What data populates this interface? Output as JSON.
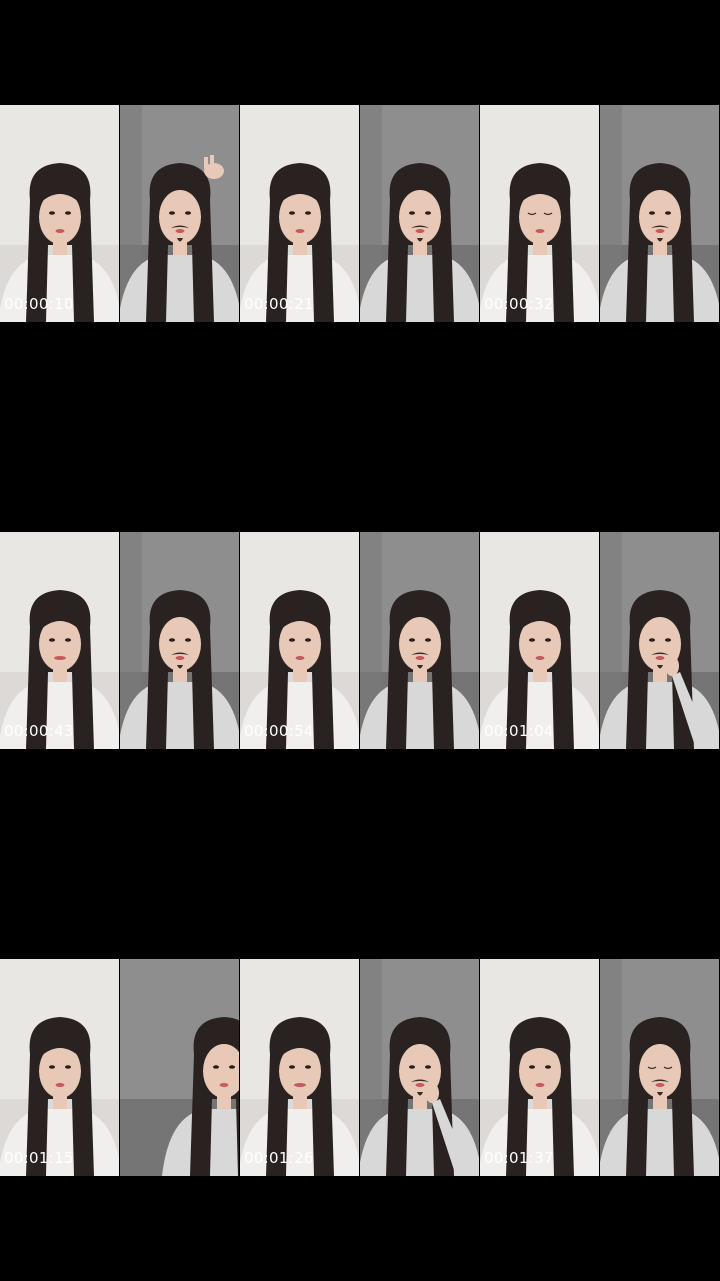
{
  "rows": [
    {
      "segments": [
        {
          "timestamp": "00:00:10",
          "frames": [
            {
              "subject": "woman-light-room"
            },
            {
              "subject": "woman-mustache-filter-peace-sign"
            }
          ]
        },
        {
          "timestamp": "00:00:21",
          "frames": [
            {
              "subject": "woman-light-room"
            },
            {
              "subject": "woman-mustache-filter"
            }
          ]
        },
        {
          "timestamp": "00:00:32",
          "frames": [
            {
              "subject": "woman-light-room-eyes-closed"
            },
            {
              "subject": "woman-mustache-filter"
            }
          ]
        }
      ]
    },
    {
      "segments": [
        {
          "timestamp": "00:00:43",
          "frames": [
            {
              "subject": "woman-light-room-smiling"
            },
            {
              "subject": "woman-mustache-filter"
            }
          ]
        },
        {
          "timestamp": "00:00:54",
          "frames": [
            {
              "subject": "woman-light-room"
            },
            {
              "subject": "woman-mustache-filter"
            }
          ]
        },
        {
          "timestamp": "00:01:04",
          "frames": [
            {
              "subject": "woman-light-room"
            },
            {
              "subject": "woman-mustache-filter-hand-to-mouth"
            }
          ]
        }
      ]
    },
    {
      "segments": [
        {
          "timestamp": "00:01:15",
          "frames": [
            {
              "subject": "woman-light-room"
            },
            {
              "subject": "woman-partially-out-of-frame"
            }
          ]
        },
        {
          "timestamp": "00:01:26",
          "frames": [
            {
              "subject": "woman-light-room-smiling"
            },
            {
              "subject": "woman-mustache-filter-hand-to-mouth"
            }
          ]
        },
        {
          "timestamp": "00:01:37",
          "frames": [
            {
              "subject": "woman-light-room"
            },
            {
              "subject": "woman-mustache-filter-eyes-closed"
            }
          ]
        }
      ]
    }
  ]
}
